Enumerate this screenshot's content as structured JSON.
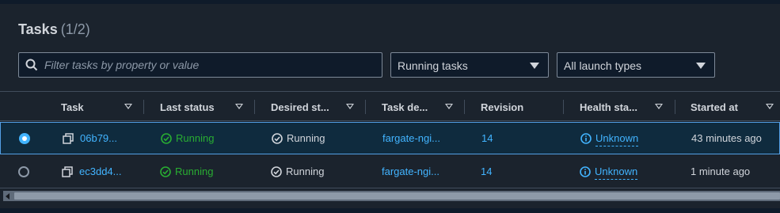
{
  "header": {
    "title": "Tasks",
    "count": "(1/2)"
  },
  "filter": {
    "placeholder": "Filter tasks by property or value"
  },
  "dropdowns": {
    "status": "Running tasks",
    "launch_type": "All launch types"
  },
  "columns": [
    "Task",
    "Last status",
    "Desired st...",
    "Task de...",
    "Revision",
    "Health sta...",
    "Started at"
  ],
  "rows": [
    {
      "task": "06b79...",
      "last_status": "Running",
      "desired_status": "Running",
      "task_def": "fargate-ngi...",
      "revision": "14",
      "health": "Unknown",
      "started": "43 minutes ago",
      "selected": true
    },
    {
      "task": "ec3dd4...",
      "last_status": "Running",
      "desired_status": "Running",
      "task_def": "fargate-ngi...",
      "revision": "14",
      "health": "Unknown",
      "started": "1 minute ago",
      "selected": false
    }
  ],
  "colors": {
    "link": "#42b4ff",
    "success": "#29ad32",
    "background": "#1b232d",
    "selected_row": "#0f2b3e"
  }
}
